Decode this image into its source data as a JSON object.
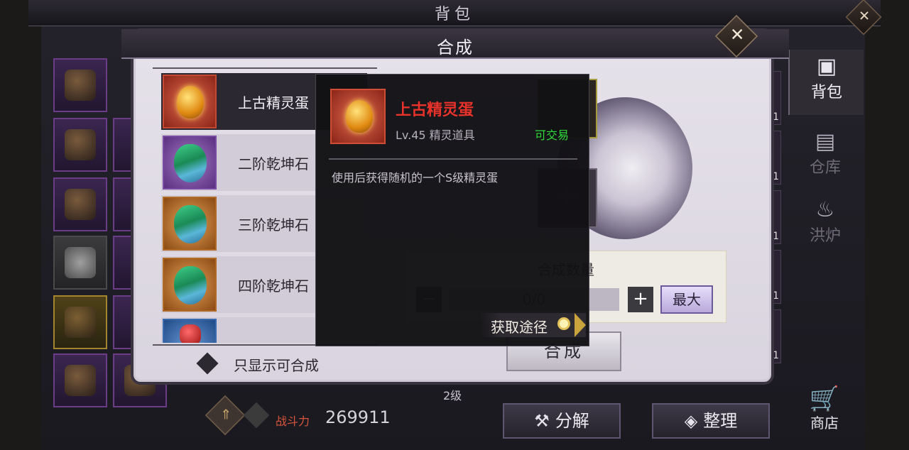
{
  "backpack": {
    "title": "背包",
    "close_icon": "close-icon",
    "level": "2级",
    "power_label": "战斗力",
    "power_value": "269911",
    "right_counts": [
      "1",
      "1",
      "1",
      "1",
      "1"
    ],
    "buttons": {
      "decompose": "分解",
      "sort": "整理"
    },
    "nav": {
      "bag": "背包",
      "storage": "仓库",
      "furnace": "洪炉",
      "shop": "商店"
    }
  },
  "synthesis": {
    "title": "合成",
    "items": [
      {
        "name": "上古精灵蛋",
        "type": "egg"
      },
      {
        "name": "二阶乾坤石",
        "type": "gem"
      },
      {
        "name": "三阶乾坤石",
        "type": "gem"
      },
      {
        "name": "四阶乾坤石",
        "type": "gem"
      },
      {
        "name": "",
        "type": "ruby"
      }
    ],
    "filter_label": "只显示可合成",
    "quantity_label": "合成数量",
    "quantity_value": "0/0",
    "minus": "−",
    "plus": "+",
    "max_label": "最大",
    "synth_button": "合成"
  },
  "tooltip": {
    "name": "上古精灵蛋",
    "level_type": "Lv.45 精灵道具",
    "tradable": "可交易",
    "description": "使用后获得随机的一个S级精灵蛋",
    "source_button": "获取途径"
  },
  "colors": {
    "item_name_red": "#e8322a",
    "tradable_green": "#2fdc3c",
    "power_red": "#d9553c"
  }
}
